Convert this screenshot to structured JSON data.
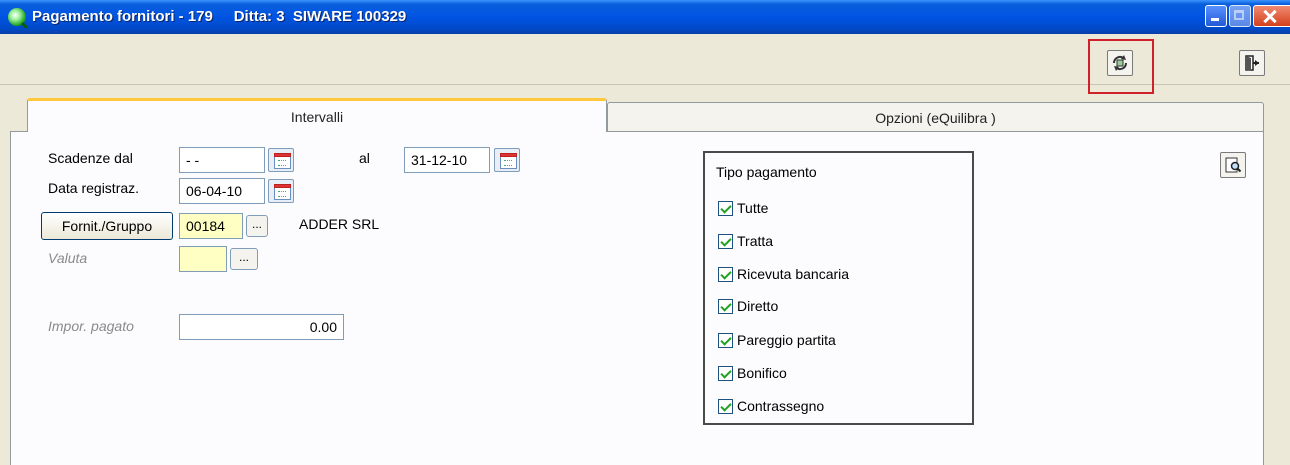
{
  "window": {
    "title": "Pagamento fornitori - 179     Ditta: 3  SIWARE 100329"
  },
  "toolbar": {
    "refresh_icon": "refresh-icon",
    "exit_icon": "exit-icon"
  },
  "tabs": [
    {
      "label": "Intervalli"
    },
    {
      "label": "Opzioni (eQuilibra )"
    }
  ],
  "form": {
    "scadenze_dal_label": "Scadenze dal",
    "scadenze_dal_value": "- -",
    "al_label": "al",
    "al_value": "31-12-10",
    "data_registraz_label": "Data registraz.",
    "data_registraz_value": "06-04-10",
    "fornit_button": "Fornit./Gruppo",
    "fornit_code": "00184",
    "ellipsis": "...",
    "fornit_name": "ADDER SRL",
    "valuta_label": "Valuta",
    "valuta_value": "",
    "impor_label": "Impor. pagato",
    "impor_value": "0.00"
  },
  "tipo_pagamento": {
    "title": "Tipo pagamento",
    "options": [
      {
        "label": "Tutte",
        "checked": true
      },
      {
        "label": "Tratta",
        "checked": true
      },
      {
        "label": "Ricevuta bancaria",
        "checked": true
      },
      {
        "label": "Diretto",
        "checked": true
      },
      {
        "label": "Pareggio partita",
        "checked": true
      },
      {
        "label": "Bonifico",
        "checked": true
      },
      {
        "label": "Contrassegno",
        "checked": true
      }
    ]
  },
  "colors": {
    "titlebar": "#0054e3",
    "tab_accent": "#ffc73c",
    "highlight": "#d0202a",
    "checkmark": "#21a121"
  }
}
